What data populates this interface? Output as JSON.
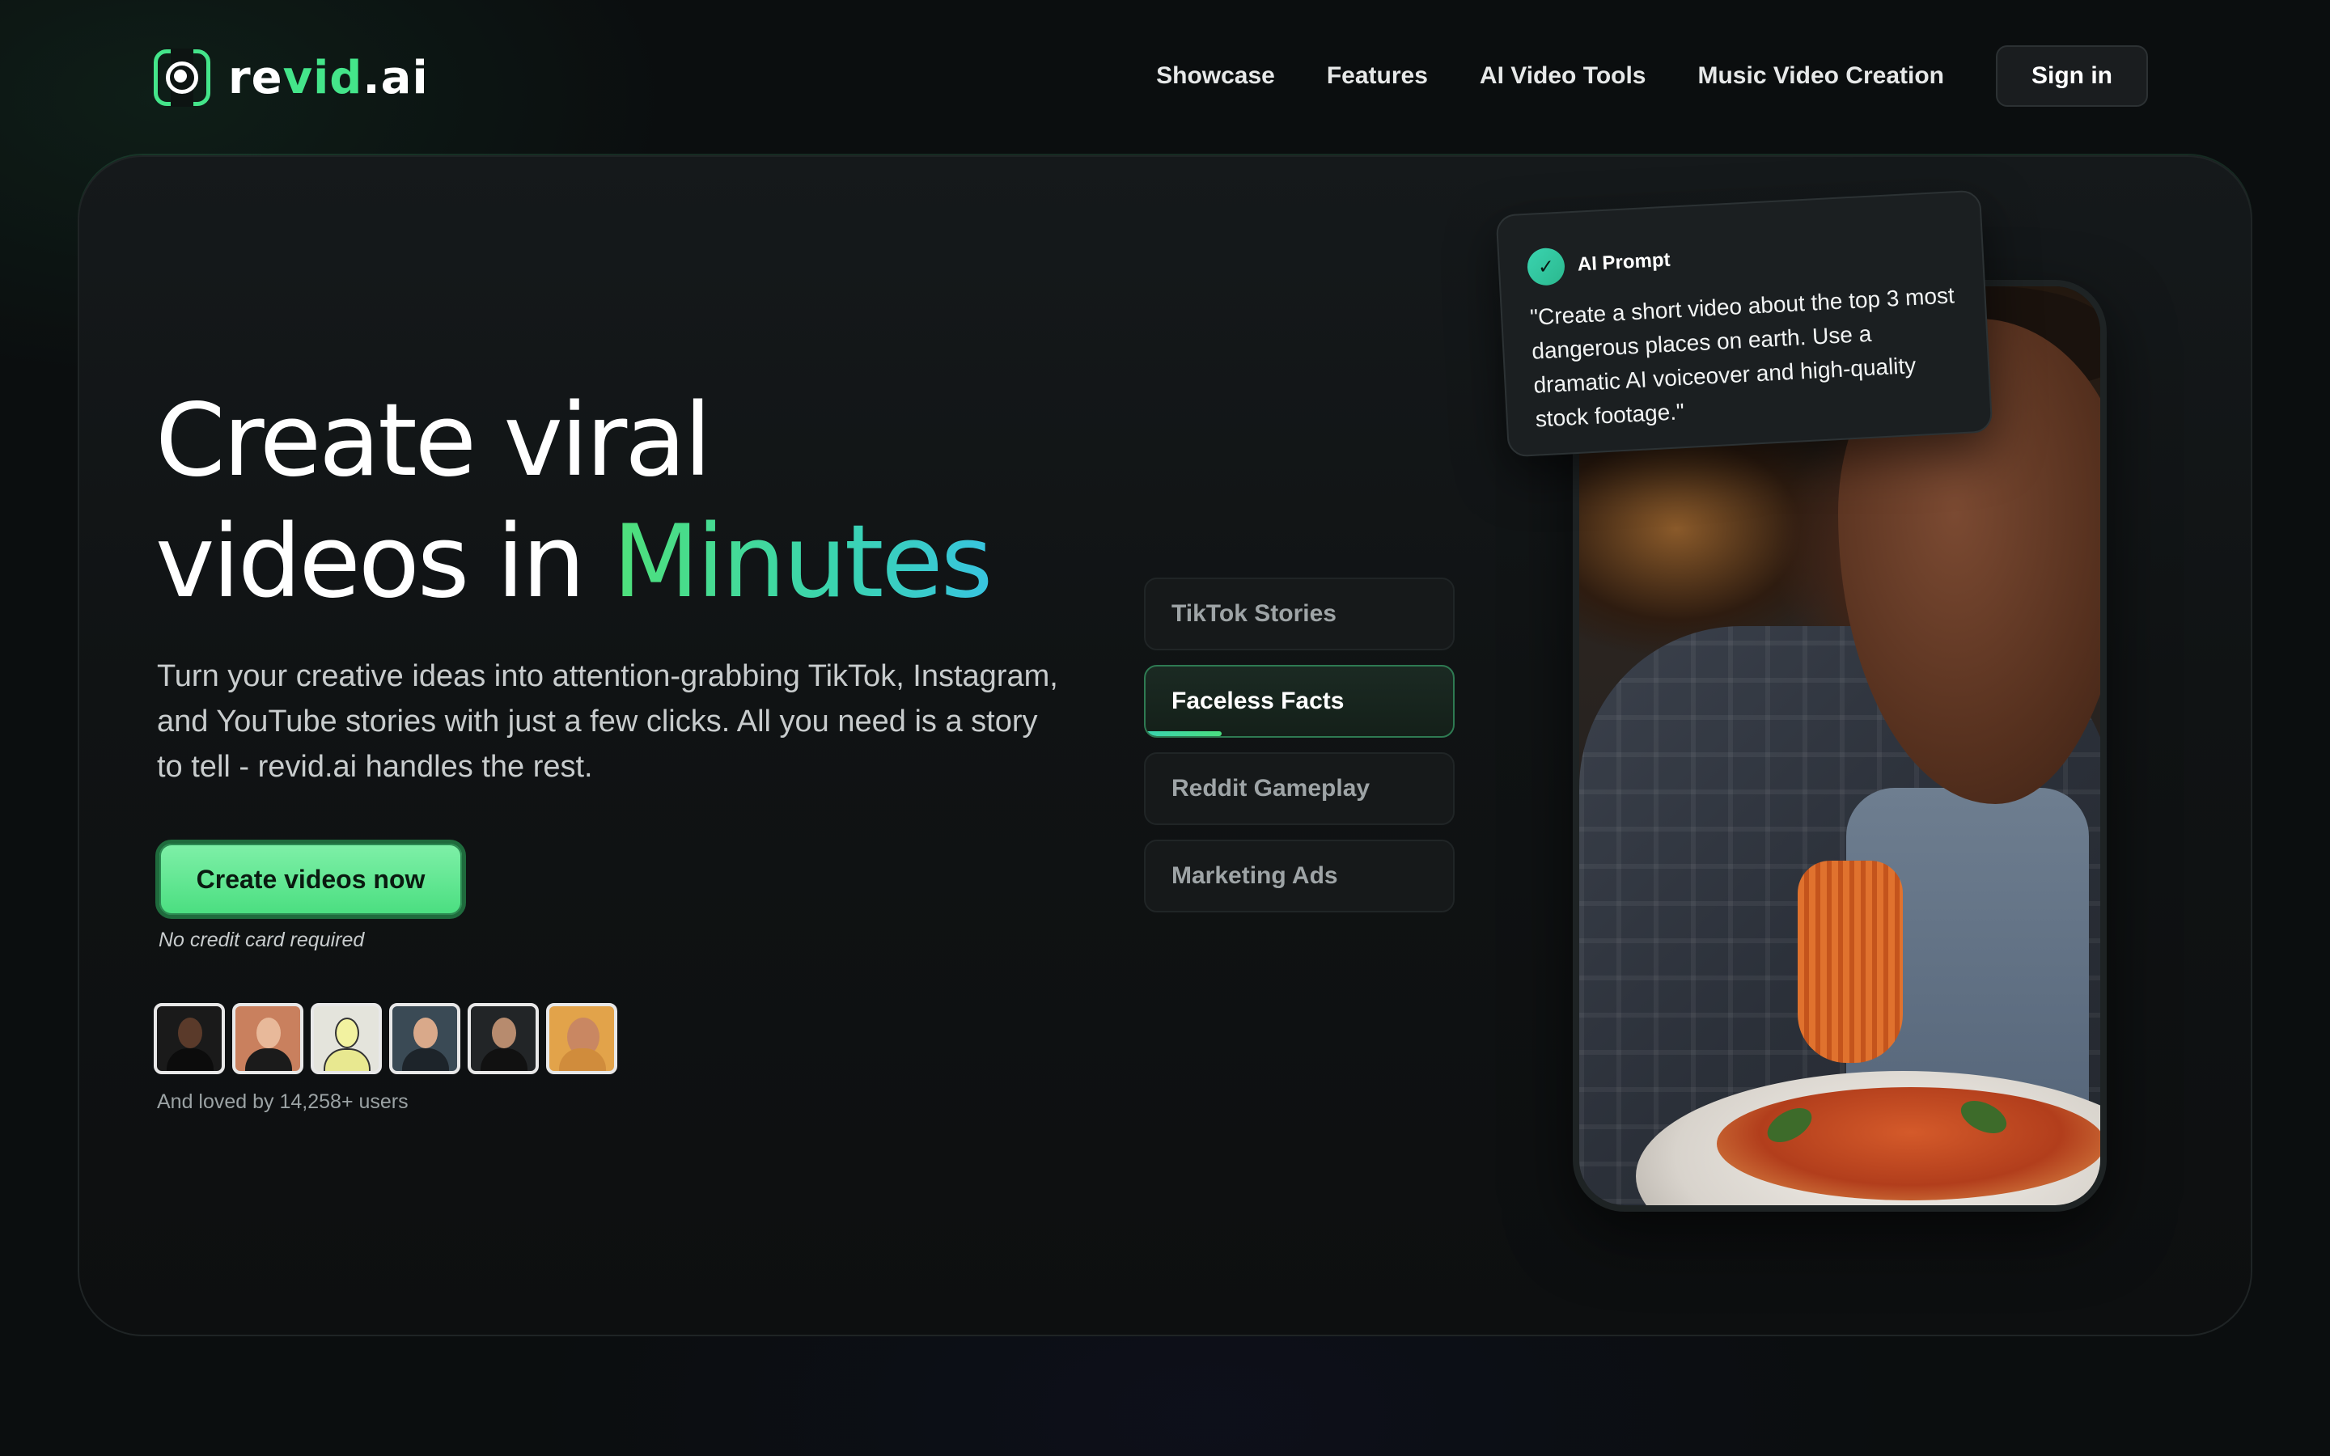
{
  "brand": {
    "name_part1": "re",
    "name_part2": "vid",
    "name_part3": ".ai",
    "accent_color": "#44e58a"
  },
  "nav": {
    "items": [
      {
        "label": "Showcase"
      },
      {
        "label": "Features"
      },
      {
        "label": "AI Video Tools"
      },
      {
        "label": "Music Video Creation"
      }
    ],
    "signin_label": "Sign in"
  },
  "hero": {
    "headline_line1": "Create viral",
    "headline_line2_prefix": "videos in ",
    "headline_line2_accent": "Minutes",
    "subtext": "Turn your creative ideas into attention-grabbing TikTok, Instagram, and YouTube stories with just a few clicks. All you need is a story to tell - revid.ai handles the rest.",
    "cta_label": "Create videos now",
    "cta_note": "No credit card required",
    "loved_text": "And loved by 14,258+ users",
    "avatars": [
      {
        "name": "user-avatar-1"
      },
      {
        "name": "user-avatar-2"
      },
      {
        "name": "user-avatar-3"
      },
      {
        "name": "user-avatar-4"
      },
      {
        "name": "user-avatar-5"
      },
      {
        "name": "user-avatar-6"
      }
    ]
  },
  "tabs": {
    "items": [
      {
        "label": "TikTok Stories",
        "active": false
      },
      {
        "label": "Faceless Facts",
        "active": true
      },
      {
        "label": "Reddit Gameplay",
        "active": false
      },
      {
        "label": "Marketing Ads",
        "active": false
      }
    ]
  },
  "prompt": {
    "label": "AI Prompt",
    "icon": "check-icon",
    "text": "\"Create a short video about the top 3 most dangerous places on earth. Use a dramatic AI voiceover and high-quality stock footage.\""
  }
}
